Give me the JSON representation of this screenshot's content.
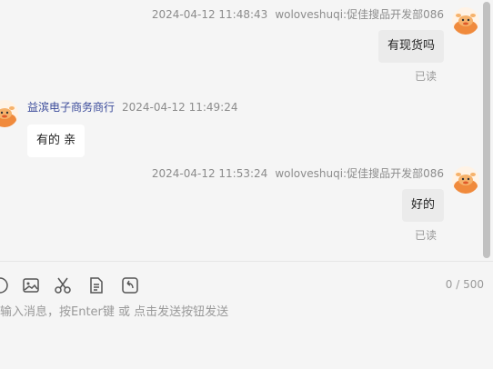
{
  "messages": [
    {
      "side": "mine",
      "time": "2024-04-12 11:48:43",
      "sender": "woloveshuqi:促佳搜品开发部086",
      "text": "有现货吗",
      "status": "已读"
    },
    {
      "side": "theirs",
      "sender": "益滨电子商务商行",
      "time": "2024-04-12 11:49:24",
      "text": "有的 亲"
    },
    {
      "side": "mine",
      "time": "2024-04-12 11:53:24",
      "sender": "woloveshuqi:促佳搜品开发部086",
      "text": "好的",
      "status": "已读"
    }
  ],
  "composer": {
    "counter": "0 / 500",
    "placeholder": "输入消息，按Enter键 或 点击发送按钮发送",
    "tools": [
      "emoji-icon",
      "image-icon",
      "scissors-icon",
      "file-icon",
      "recall-icon"
    ]
  },
  "colors": {
    "background": "#f5f5f5",
    "bubble_mine": "#ebebeb",
    "bubble_theirs": "#ffffff",
    "shop_name": "#3a4a9a",
    "avatar_accent": "#f08a3c"
  }
}
